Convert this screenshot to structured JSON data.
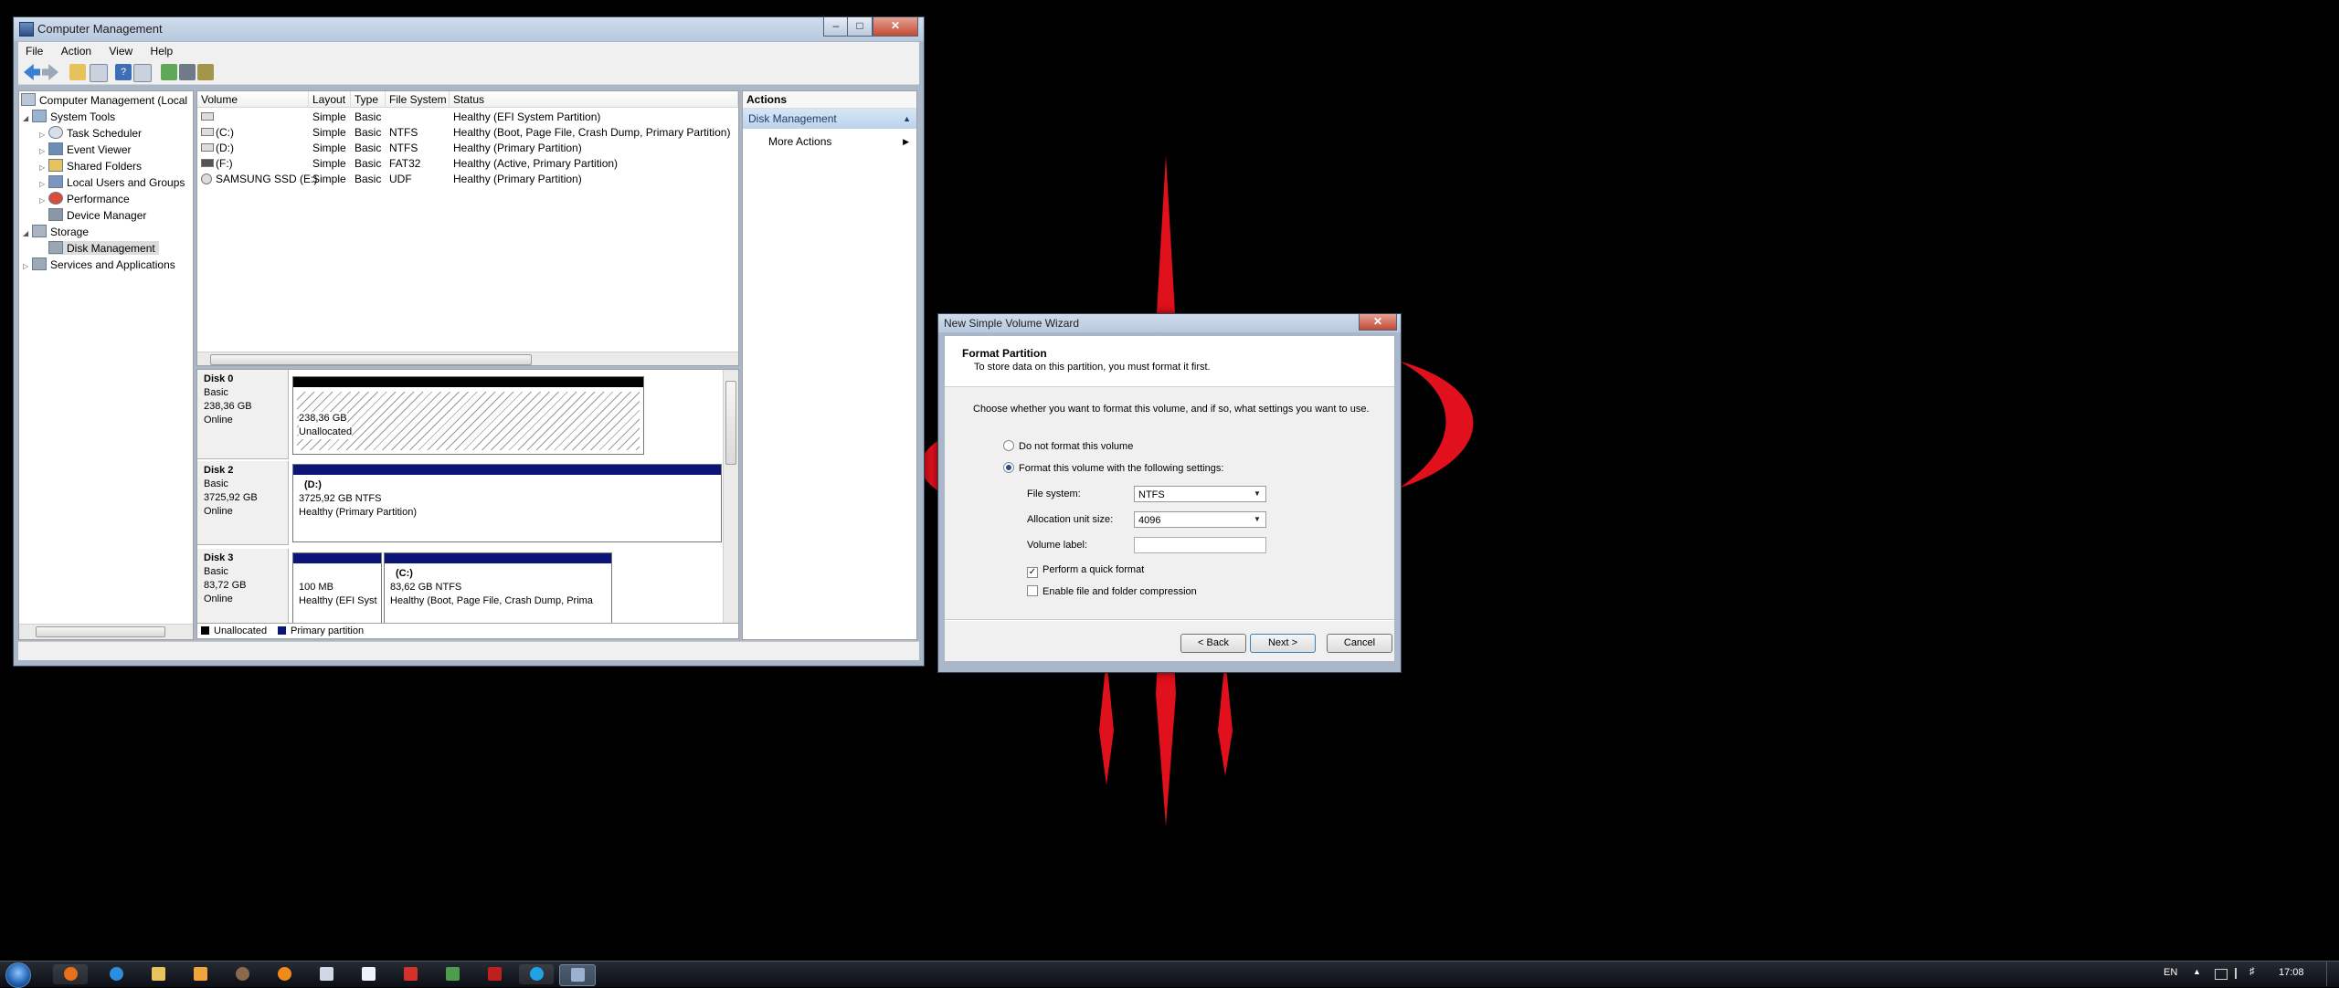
{
  "computer_management": {
    "title": "Computer Management",
    "menu": [
      "File",
      "Action",
      "View",
      "Help"
    ],
    "tree": [
      {
        "label": "Computer Management (Local",
        "level": 0
      },
      {
        "label": "System Tools",
        "level": 1
      },
      {
        "label": "Task Scheduler",
        "level": 2
      },
      {
        "label": "Event Viewer",
        "level": 2
      },
      {
        "label": "Shared Folders",
        "level": 2
      },
      {
        "label": "Local Users and Groups",
        "level": 2
      },
      {
        "label": "Performance",
        "level": 2
      },
      {
        "label": "Device Manager",
        "level": 2
      },
      {
        "label": "Storage",
        "level": 1
      },
      {
        "label": "Disk Management",
        "level": 2
      },
      {
        "label": "Services and Applications",
        "level": 1
      }
    ],
    "volume_table": {
      "columns": [
        "Volume",
        "Layout",
        "Type",
        "File System",
        "Status"
      ],
      "rows": [
        {
          "volume": "",
          "layout": "Simple",
          "type": "Basic",
          "fs": "",
          "status": "Healthy (EFI System Partition)"
        },
        {
          "volume": "(C:)",
          "layout": "Simple",
          "type": "Basic",
          "fs": "NTFS",
          "status": "Healthy (Boot, Page File, Crash Dump, Primary Partition)"
        },
        {
          "volume": "(D:)",
          "layout": "Simple",
          "type": "Basic",
          "fs": "NTFS",
          "status": "Healthy (Primary Partition)"
        },
        {
          "volume": "(F:)",
          "layout": "Simple",
          "type": "Basic",
          "fs": "FAT32",
          "status": "Healthy (Active, Primary Partition)"
        },
        {
          "volume": "SAMSUNG SSD (E:)",
          "layout": "Simple",
          "type": "Basic",
          "fs": "UDF",
          "status": "Healthy (Primary Partition)"
        }
      ]
    },
    "disks": [
      {
        "name": "Disk 0",
        "kind": "Basic",
        "size": "238,36 GB",
        "state": "Online",
        "partitions": [
          {
            "letter": "",
            "size": "238,36 GB",
            "status": "Unallocated"
          }
        ]
      },
      {
        "name": "Disk 2",
        "kind": "Basic",
        "size": "3725,92 GB",
        "state": "Online",
        "partitions": [
          {
            "letter": "(D:)",
            "size": "3725,92 GB NTFS",
            "status": "Healthy (Primary Partition)"
          }
        ]
      },
      {
        "name": "Disk 3",
        "kind": "Basic",
        "size": "83,72 GB",
        "state": "Online",
        "partitions": [
          {
            "letter": "",
            "size": "100 MB",
            "status": "Healthy (EFI Syst"
          },
          {
            "letter": "(C:)",
            "size": "83,62 GB NTFS",
            "status": "Healthy (Boot, Page File, Crash Dump, Prima"
          }
        ]
      }
    ],
    "legend": [
      "Unallocated",
      "Primary partition"
    ],
    "actions": {
      "header": "Actions",
      "section": "Disk Management",
      "more": "More Actions"
    }
  },
  "wizard": {
    "title": "New Simple Volume Wizard",
    "heading": "Format Partition",
    "subheading": "To store data on this partition, you must format it first.",
    "instruction": "Choose whether you want to format this volume, and if so, what settings you want to use.",
    "option_no_format": "Do not format this volume",
    "option_format": "Format this volume with the following settings:",
    "file_system_label": "File system:",
    "file_system_value": "NTFS",
    "alloc_label": "Allocation unit size:",
    "alloc_value": "4096",
    "volume_label_label": "Volume label:",
    "volume_label_value": "",
    "quick_format": "Perform a quick format",
    "compression": "Enable file and folder compression",
    "back": "< Back",
    "next": "Next >",
    "cancel": "Cancel"
  },
  "taskbar": {
    "language": "EN",
    "clock": "17:08"
  },
  "colors": {
    "primary_partition": "#0b1577",
    "wallpaper_accent": "#e3071a"
  }
}
